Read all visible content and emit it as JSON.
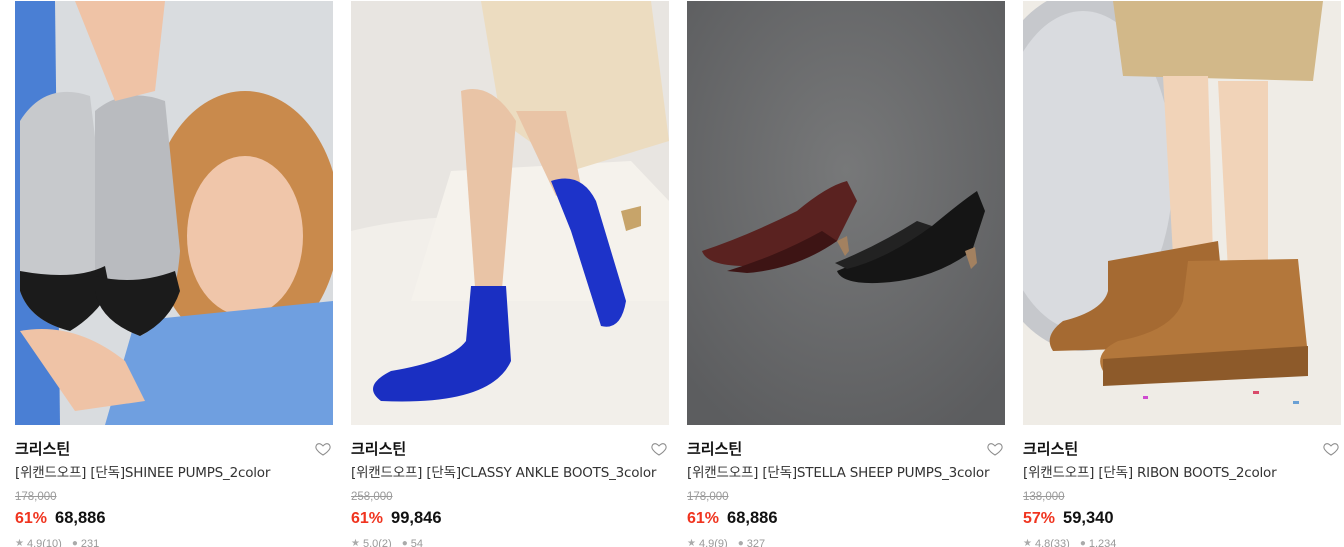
{
  "products": [
    {
      "brand": "크리스틴",
      "title": "[위캔드오프] [단독]SHINEE PUMPS_2color",
      "original_price": "178,000",
      "discount": "61%",
      "price": "68,886",
      "rating": "4.9(10)",
      "reviews": "231",
      "image_alt": "silver ballet pumps held by model",
      "wish_icon": "heart-outline-icon"
    },
    {
      "brand": "크리스틴",
      "title": "[위캔드오프] [단독]CLASSY ANKLE BOOTS_3color",
      "original_price": "258,000",
      "discount": "61%",
      "price": "99,846",
      "rating": "5.0(2)",
      "reviews": "54",
      "image_alt": "blue suede ankle boots",
      "wish_icon": "heart-outline-icon"
    },
    {
      "brand": "크리스틴",
      "title": "[위캔드오프] [단독]STELLA SHEEP PUMPS_3color",
      "original_price": "178,000",
      "discount": "61%",
      "price": "68,886",
      "rating": "4.9(9)",
      "reviews": "327",
      "image_alt": "brown and black pointed pumps",
      "wish_icon": "heart-outline-icon"
    },
    {
      "brand": "크리스틴",
      "title": "[위캔드오프] [단독] RIBON BOOTS_2color",
      "original_price": "138,000",
      "discount": "57%",
      "price": "59,340",
      "rating": "4.8(33)",
      "reviews": "1,234",
      "image_alt": "tan ribbon ankle boots",
      "wish_icon": "heart-outline-icon"
    }
  ],
  "colors": {
    "discount": "#f0341f",
    "text": "#111111",
    "muted": "#9a9a9a"
  }
}
